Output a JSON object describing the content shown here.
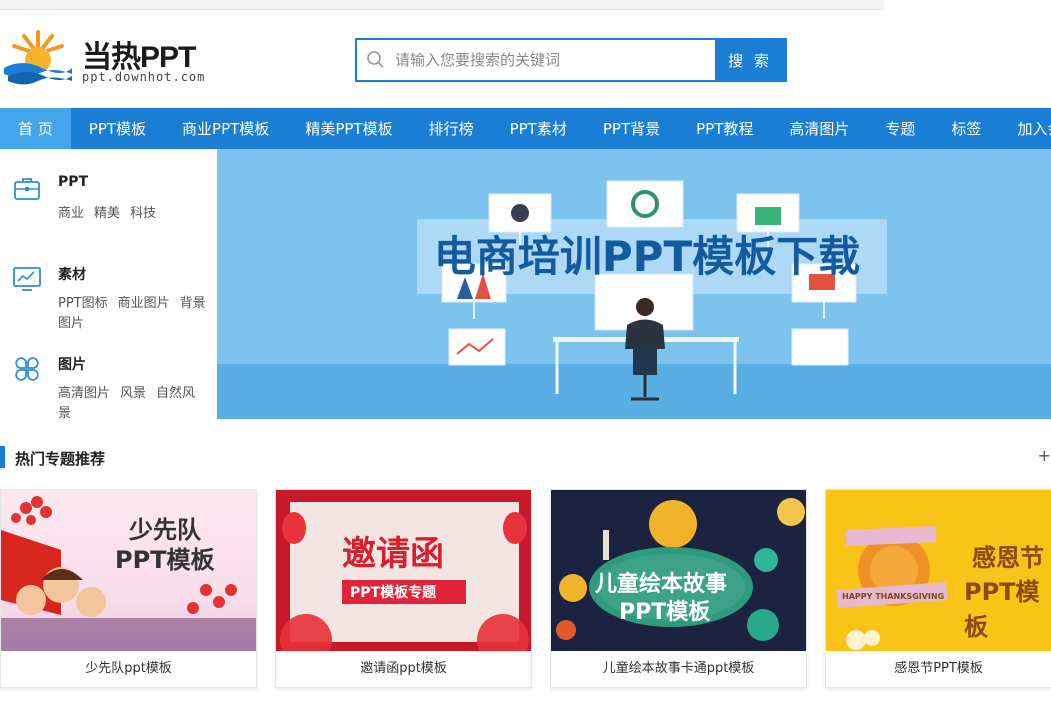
{
  "colors": {
    "brand_blue": "#1a7ed4",
    "nav_active": "#45a5ea",
    "banner_bg": "#7cc3ee"
  },
  "logo": {
    "title": "当热PPT",
    "subtitle": "ppt.downhot.com"
  },
  "search": {
    "placeholder": "请输入您要搜索的关键词",
    "button_label": "搜 索"
  },
  "nav": {
    "items": [
      {
        "label": "首 页",
        "active": true
      },
      {
        "label": "PPT模板"
      },
      {
        "label": "商业PPT模板"
      },
      {
        "label": "精美PPT模板"
      },
      {
        "label": "排行榜"
      },
      {
        "label": "PPT素材"
      },
      {
        "label": "PPT背景"
      },
      {
        "label": "PPT教程"
      },
      {
        "label": "高清图片"
      },
      {
        "label": "专题"
      },
      {
        "label": "标签"
      },
      {
        "label": "加入会员"
      }
    ]
  },
  "sidebar": {
    "categories": [
      {
        "title": "PPT",
        "icon": "briefcase-icon",
        "links": [
          "商业",
          "精美",
          "科技"
        ]
      },
      {
        "title": "素材",
        "icon": "chart-monitor-icon",
        "links": [
          "PPT图标",
          "商业图片",
          "背景图片"
        ]
      },
      {
        "title": "图片",
        "icon": "clover-icon",
        "links": [
          "高清图片",
          "风景",
          "自然风景"
        ]
      }
    ]
  },
  "banner": {
    "headline": "电商培训PPT模板下载"
  },
  "hot_topics": {
    "title": "热门专题推荐",
    "more": "+",
    "cards": [
      {
        "label": "少先队ppt模板",
        "art_line1": "少先队",
        "art_line2": "PPT模板"
      },
      {
        "label": "邀请函ppt模板",
        "art_line1": "邀请函",
        "art_line2": "PPT模板专题"
      },
      {
        "label": "儿童绘本故事卡通ppt模板",
        "art_line1": "儿童绘本故事",
        "art_line2": "PPT模板"
      },
      {
        "label": "感恩节PPT模板",
        "art_line1": "感恩节",
        "art_line2": "PPT模板",
        "art_badge": "HAPPY THANKSGIVING"
      }
    ]
  }
}
